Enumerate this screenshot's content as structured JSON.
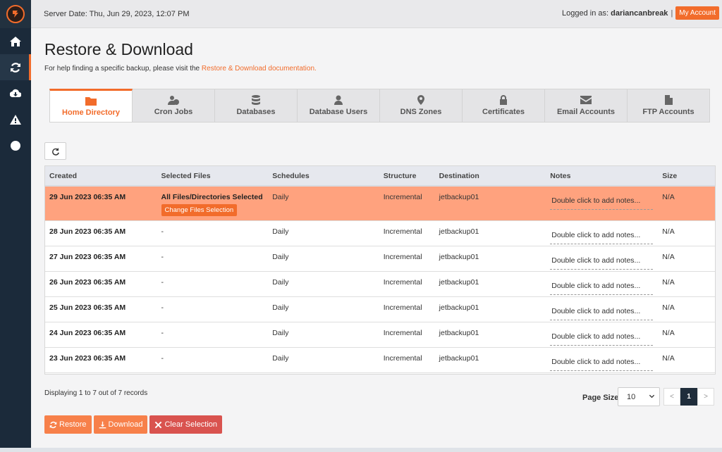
{
  "topbar": {
    "server_date": "Server Date: Thu, Jun 29, 2023, 12:07 PM",
    "logged_in_label": "Logged in as:",
    "username": "dariancanbreak",
    "separator": "|",
    "my_account": "My Account"
  },
  "sidebar": {
    "items": [
      {
        "icon": "home-icon"
      },
      {
        "icon": "refresh-icon",
        "active": true
      },
      {
        "icon": "cloud-download-icon"
      },
      {
        "icon": "warning-icon"
      },
      {
        "icon": "clock-icon"
      }
    ]
  },
  "page": {
    "title": "Restore & Download",
    "help_text": "For help finding a specific backup, please visit the ",
    "help_link": "Restore & Download documentation."
  },
  "tabs": [
    {
      "label": "Home Directory",
      "icon": "folder-icon",
      "active": true
    },
    {
      "label": "Cron Jobs",
      "icon": "user-clock-icon"
    },
    {
      "label": "Databases",
      "icon": "database-icon"
    },
    {
      "label": "Database Users",
      "icon": "user-tie-icon"
    },
    {
      "label": "DNS Zones",
      "icon": "map-marker-icon"
    },
    {
      "label": "Certificates",
      "icon": "lock-icon"
    },
    {
      "label": "Email Accounts",
      "icon": "envelope-icon"
    },
    {
      "label": "FTP Accounts",
      "icon": "file-icon"
    }
  ],
  "table": {
    "headers": [
      "Created",
      "Selected Files",
      "Schedules",
      "Structure",
      "Destination",
      "Notes",
      "Size"
    ],
    "rows": [
      {
        "created": "29 Jun 2023 06:35 AM",
        "files": "All Files/Directories Selected",
        "change": "Change Files Selection",
        "schedule": "Daily",
        "structure": "Incremental",
        "destination": "jetbackup01",
        "notes": "Double click to add notes...",
        "size": "N/A",
        "selected": true
      },
      {
        "created": "28 Jun 2023 06:35 AM",
        "files": "-",
        "schedule": "Daily",
        "structure": "Incremental",
        "destination": "jetbackup01",
        "notes": "Double click to add notes...",
        "size": "N/A"
      },
      {
        "created": "27 Jun 2023 06:35 AM",
        "files": "-",
        "schedule": "Daily",
        "structure": "Incremental",
        "destination": "jetbackup01",
        "notes": "Double click to add notes...",
        "size": "N/A"
      },
      {
        "created": "26 Jun 2023 06:35 AM",
        "files": "-",
        "schedule": "Daily",
        "structure": "Incremental",
        "destination": "jetbackup01",
        "notes": "Double click to add notes...",
        "size": "N/A"
      },
      {
        "created": "25 Jun 2023 06:35 AM",
        "files": "-",
        "schedule": "Daily",
        "structure": "Incremental",
        "destination": "jetbackup01",
        "notes": "Double click to add notes...",
        "size": "N/A"
      },
      {
        "created": "24 Jun 2023 06:35 AM",
        "files": "-",
        "schedule": "Daily",
        "structure": "Incremental",
        "destination": "jetbackup01",
        "notes": "Double click to add notes...",
        "size": "N/A"
      },
      {
        "created": "23 Jun 2023 06:35 AM",
        "files": "-",
        "schedule": "Daily",
        "structure": "Incremental",
        "destination": "jetbackup01",
        "notes": "Double click to add notes...",
        "size": "N/A"
      }
    ]
  },
  "footer": {
    "displaying": "Displaying 1 to 7 out of 7 records",
    "page_size_label": "Page Size",
    "page_size_value": "10",
    "prev": "<",
    "current_page": "1",
    "next": ">"
  },
  "actions": {
    "restore": "Restore",
    "download": "Download",
    "clear": "Clear Selection"
  },
  "colors": {
    "accent": "#f26c2b",
    "selected_row": "#ffa27e",
    "sidebar": "#1b2a3a",
    "danger": "#d9534f"
  }
}
